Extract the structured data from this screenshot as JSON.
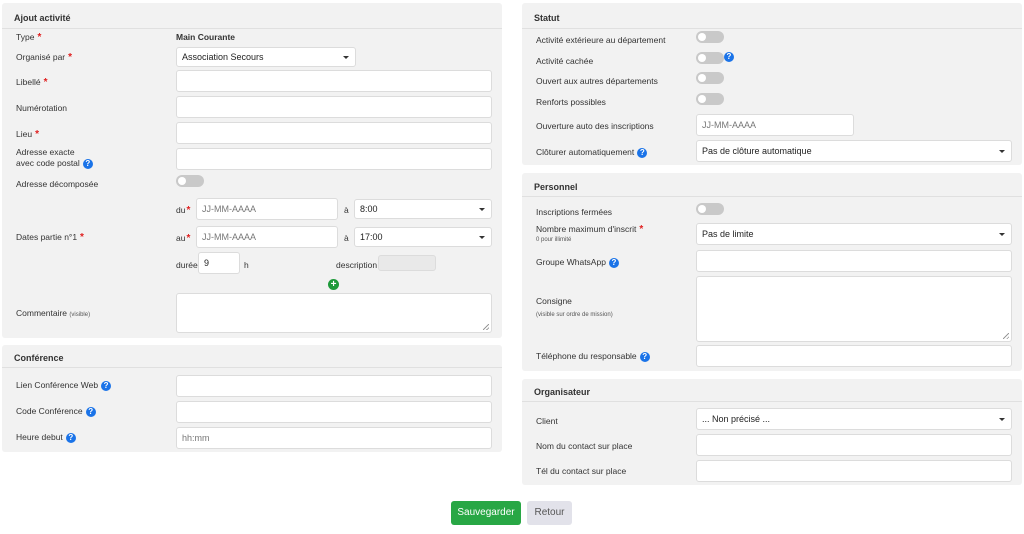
{
  "ajout": {
    "title": "Ajout activité",
    "type_label": "Type",
    "type_value": "Main Courante",
    "organise_label": "Organisé par",
    "organise_value": "Association Secours",
    "libelle_label": "Libellé",
    "numerotation_label": "Numérotation",
    "lieu_label": "Lieu",
    "adresse_line1": "Adresse exacte",
    "adresse_line2": "avec code postal",
    "adresse_decomposee_label": "Adresse décomposée",
    "dates_label": "Dates partie n°1",
    "du_label": "du",
    "au_label": "au",
    "a_label": "à",
    "date_placeholder": "JJ-MM-AAAA",
    "start_time": "8:00",
    "end_time": "17:00",
    "duree_label": "durée",
    "duree_value": "9",
    "h_label": "h",
    "description_label": "description",
    "commentaire_label": "Commentaire",
    "commentaire_hint": "(visible)"
  },
  "conference": {
    "title": "Conférence",
    "lien_label": "Lien Conférence Web",
    "code_label": "Code Conférence",
    "heure_label": "Heure debut",
    "heure_placeholder": "hh:mm"
  },
  "statut": {
    "title": "Statut",
    "exterieure_label": "Activité extérieure au département",
    "cachee_label": "Activité cachée",
    "ouvert_label": "Ouvert aux autres départements",
    "renforts_label": "Renforts possibles",
    "ouverture_label": "Ouverture auto des inscriptions",
    "ouverture_placeholder": "JJ-MM-AAAA",
    "cloturer_label": "Clôturer automatiquement",
    "cloturer_value": "Pas de clôture automatique"
  },
  "personnel": {
    "title": "Personnel",
    "fermees_label": "Inscriptions fermées",
    "max_label": "Nombre maximum d'inscrit",
    "max_hint": "0 pour illimité",
    "max_value": "Pas de limite",
    "whatsapp_label": "Groupe WhatsApp",
    "consigne_label": "Consigne",
    "consigne_hint": "(visible sur ordre de mission)",
    "telephone_label": "Téléphone du responsable"
  },
  "organisateur": {
    "title": "Organisateur",
    "client_label": "Client",
    "client_value": "... Non précisé ...",
    "contact_label": "Nom du contact sur place",
    "tel_label": "Tél du contact sur place"
  },
  "actions": {
    "save_label": "Sauvegarder",
    "back_label": "Retour"
  },
  "colors": {
    "save": "#28a745",
    "help": "#1a73e8",
    "required": "#e02020",
    "add": "#1e9a3a"
  }
}
